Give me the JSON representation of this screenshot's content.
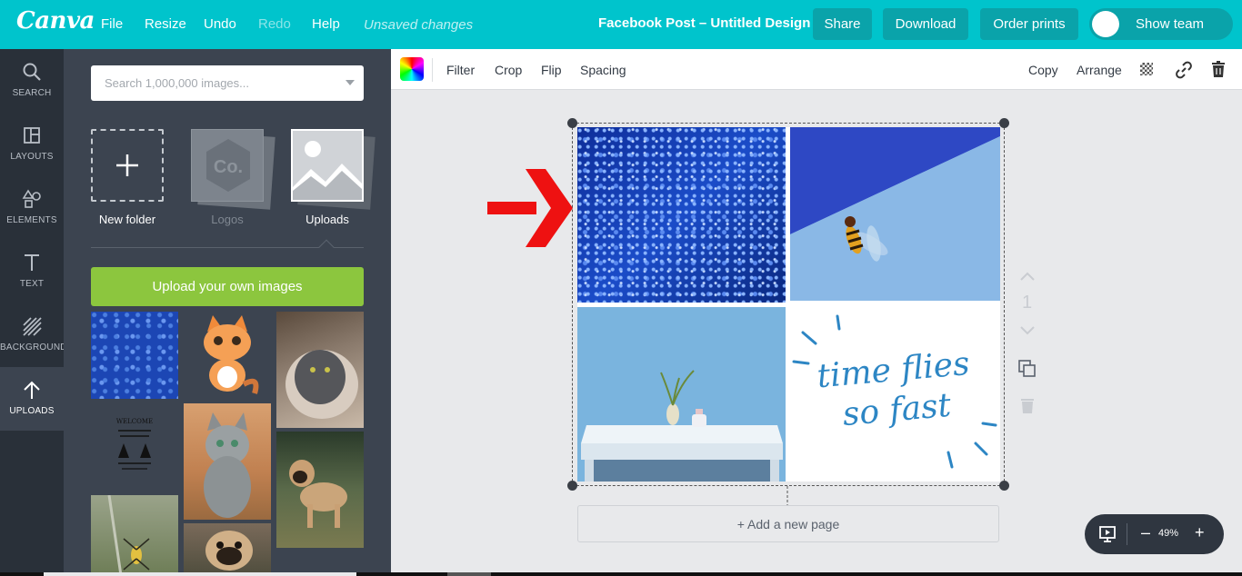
{
  "topbar": {
    "logo": "Canva",
    "menu": [
      "File",
      "Resize",
      "Undo",
      "Redo",
      "Help"
    ],
    "unsaved": "Unsaved changes",
    "doc_title": "Facebook Post – Untitled Design",
    "share": "Share",
    "download": "Download",
    "order_prints": "Order prints",
    "show_team": "Show team"
  },
  "leftnav": [
    {
      "label": "SEARCH",
      "icon": "search-icon"
    },
    {
      "label": "LAYOUTS",
      "icon": "layouts-icon"
    },
    {
      "label": "ELEMENTS",
      "icon": "elements-icon"
    },
    {
      "label": "TEXT",
      "icon": "text-icon"
    },
    {
      "label": "BACKGROUND",
      "icon": "background-icon"
    },
    {
      "label": "UPLOADS",
      "icon": "upload-arrow-icon",
      "active": true
    }
  ],
  "panel": {
    "search_placeholder": "Search 1,000,000 images...",
    "folders": [
      {
        "label": "New folder"
      },
      {
        "label": "Logos",
        "logo_mark": "Co."
      },
      {
        "label": "Uploads"
      }
    ],
    "upload_button": "Upload your own images"
  },
  "toolbar": {
    "left": [
      "Filter",
      "Crop",
      "Flip",
      "Spacing"
    ],
    "right": [
      "Copy",
      "Arrange"
    ]
  },
  "design": {
    "quote_line1": "time flies",
    "quote_line2": "so fast",
    "page_number": "1"
  },
  "add_page": "+ Add a new page",
  "zoom": {
    "minus": "–",
    "value": "49%",
    "plus": "+"
  },
  "colors": {
    "topbar": "#00c4cc",
    "button": "#0aa3aa",
    "nav": "#293039",
    "panel": "#3c4450",
    "upload_green": "#8cc63e",
    "arrow_red": "#ee1111",
    "quote_blue": "#2d86c4"
  }
}
